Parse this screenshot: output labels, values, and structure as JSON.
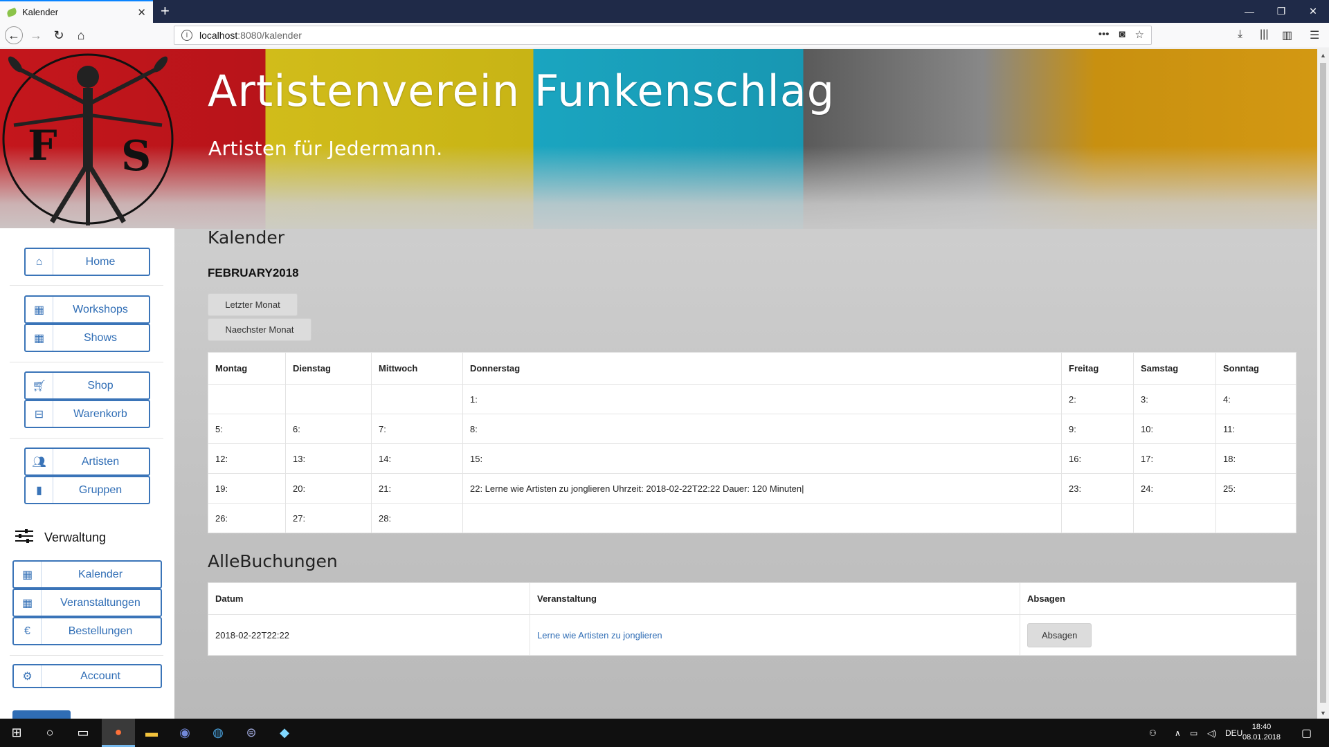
{
  "browser": {
    "tab_title": "Kalender",
    "url_host": "localhost",
    "url_path": ":8080/kalender"
  },
  "site": {
    "title": "Artistenverein Funkenschlag",
    "subtitle": "Artisten für Jedermann."
  },
  "sidebar": {
    "items": [
      {
        "label": "Home",
        "icon": "home-icon"
      },
      {
        "label": "Workshops",
        "icon": "grid-icon"
      },
      {
        "label": "Shows",
        "icon": "grid-icon"
      },
      {
        "label": "Shop",
        "icon": "cart-icon"
      },
      {
        "label": "Warenkorb",
        "icon": "basket-icon"
      },
      {
        "label": "Artisten",
        "icon": "users-icon"
      },
      {
        "label": "Gruppen",
        "icon": "bookmark-icon"
      }
    ],
    "admin_heading": "Verwaltung",
    "admin_items": [
      {
        "label": "Kalender",
        "icon": "calendar-icon"
      },
      {
        "label": "Veranstaltungen",
        "icon": "calendar-icon"
      },
      {
        "label": "Bestellungen",
        "icon": "euro-icon"
      },
      {
        "label": "Account",
        "icon": "gears-icon"
      }
    ]
  },
  "calendar": {
    "heading": "Kalender",
    "month": "FEBRUARY2018",
    "prev_label": "Letzter Monat",
    "next_label": "Naechster Monat",
    "weekdays": [
      "Montag",
      "Dienstag",
      "Mittwoch",
      "Donnerstag",
      "Freitag",
      "Samstag",
      "Sonntag"
    ],
    "weeks": [
      [
        "",
        "",
        "",
        "1:",
        "2:",
        "3:",
        "4:"
      ],
      [
        "5:",
        "6:",
        "7:",
        "8:",
        "9:",
        "10:",
        "11:"
      ],
      [
        "12:",
        "13:",
        "14:",
        "15:",
        "16:",
        "17:",
        "18:"
      ],
      [
        "19:",
        "20:",
        "21:",
        "22: Lerne wie Artisten zu jonglieren Uhrzeit: 2018-02-22T22:22 Dauer: 120 Minuten|",
        "23:",
        "24:",
        "25:"
      ],
      [
        "26:",
        "27:",
        "28:",
        "",
        "",
        "",
        ""
      ]
    ]
  },
  "bookings": {
    "heading": "AlleBuchungen",
    "columns": [
      "Datum",
      "Veranstaltung",
      "Absagen"
    ],
    "rows": [
      {
        "date": "2018-02-22T22:22",
        "event": "Lerne wie Artisten zu jonglieren",
        "action": "Absagen"
      }
    ]
  },
  "taskbar": {
    "lang": "DEU",
    "time": "18:40",
    "date": "08.01.2018"
  },
  "colors": {
    "accent": "#2f6db5",
    "browser_frame": "#1f2a48"
  }
}
